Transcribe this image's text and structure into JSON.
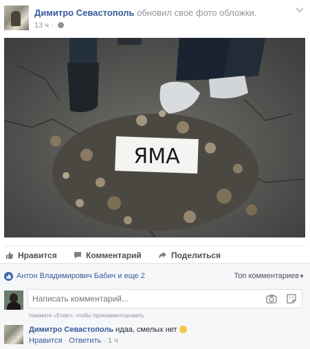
{
  "post": {
    "author": "Димитро Севастополь",
    "action": "обновил свое фото обложки.",
    "time": "13 ч",
    "photo_sign_text": "ЯМА"
  },
  "actions": {
    "like": "Нравится",
    "comment": "Комментарий",
    "share": "Поделиться"
  },
  "reactions": {
    "likers": "Антон Владимирович Бабич и еще 2",
    "sort": "Топ комментариев"
  },
  "composer": {
    "placeholder": "Написать комментарий...",
    "hint": "Нажмите «Enter», чтобы прокомментировать."
  },
  "comment": {
    "author": "Димитро Севастополь",
    "text": "ндаа, смелых нет",
    "like": "Нравится",
    "reply": "Ответить",
    "time": "1 ч"
  },
  "colors": {
    "link": "#365899",
    "like_blue": "#4267b2",
    "muted": "#90949c"
  }
}
